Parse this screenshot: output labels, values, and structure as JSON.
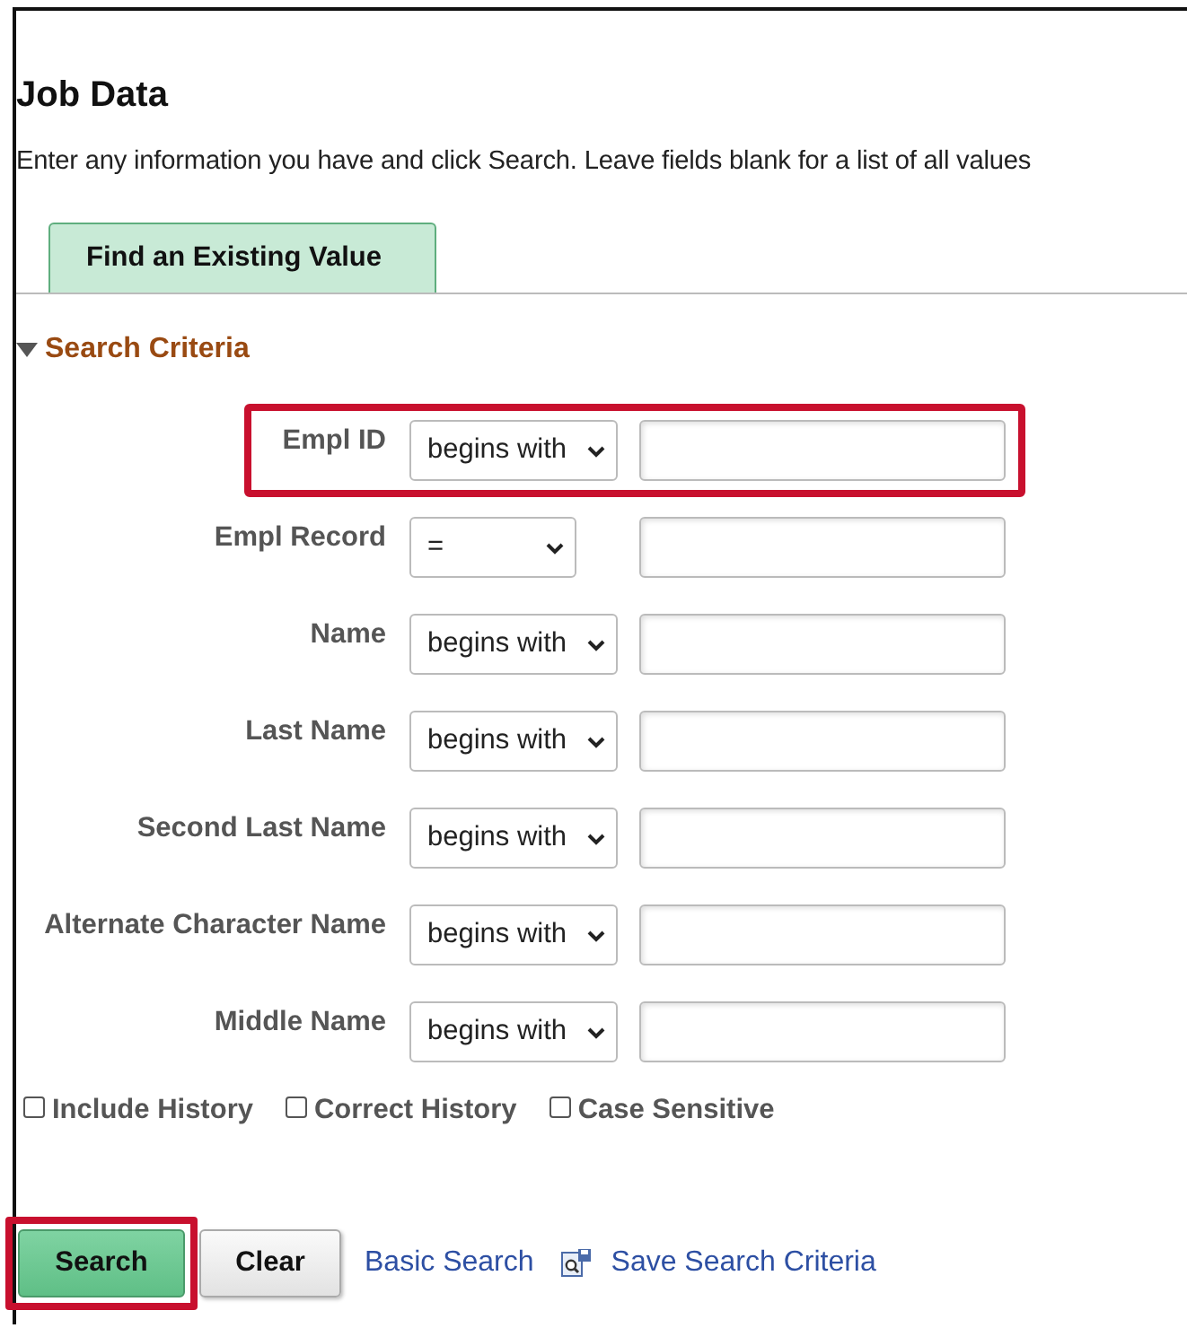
{
  "page": {
    "title": "Job Data",
    "instructions": "Enter any information you have and click Search. Leave fields blank for a list of all values"
  },
  "tabs": [
    {
      "label": "Find an Existing Value",
      "selected": true
    }
  ],
  "section": {
    "title": "Search Criteria",
    "expanded": true
  },
  "criteria": [
    {
      "label": "Empl ID",
      "operator": "begins with",
      "highlighted": true
    },
    {
      "label": "Empl Record",
      "operator": "=",
      "highlighted": false
    },
    {
      "label": "Name",
      "operator": "begins with",
      "highlighted": false
    },
    {
      "label": "Last Name",
      "operator": "begins with",
      "highlighted": false
    },
    {
      "label": "Second Last Name",
      "operator": "begins with",
      "highlighted": false
    },
    {
      "label": "Alternate Character Name",
      "operator": "begins with",
      "highlighted": false
    },
    {
      "label": "Middle Name",
      "operator": "begins with",
      "highlighted": false
    }
  ],
  "options": [
    {
      "label": "Include History",
      "checked": false
    },
    {
      "label": "Correct History",
      "checked": false
    },
    {
      "label": "Case Sensitive",
      "checked": false
    }
  ],
  "actions": [
    {
      "kind": "primary",
      "label": "Search",
      "highlighted": true
    },
    {
      "kind": "secondary",
      "label": "Clear",
      "highlighted": false
    },
    {
      "kind": "link",
      "label": "Basic Search"
    },
    {
      "kind": "icon-link",
      "label": "Save Search Criteria"
    }
  ]
}
